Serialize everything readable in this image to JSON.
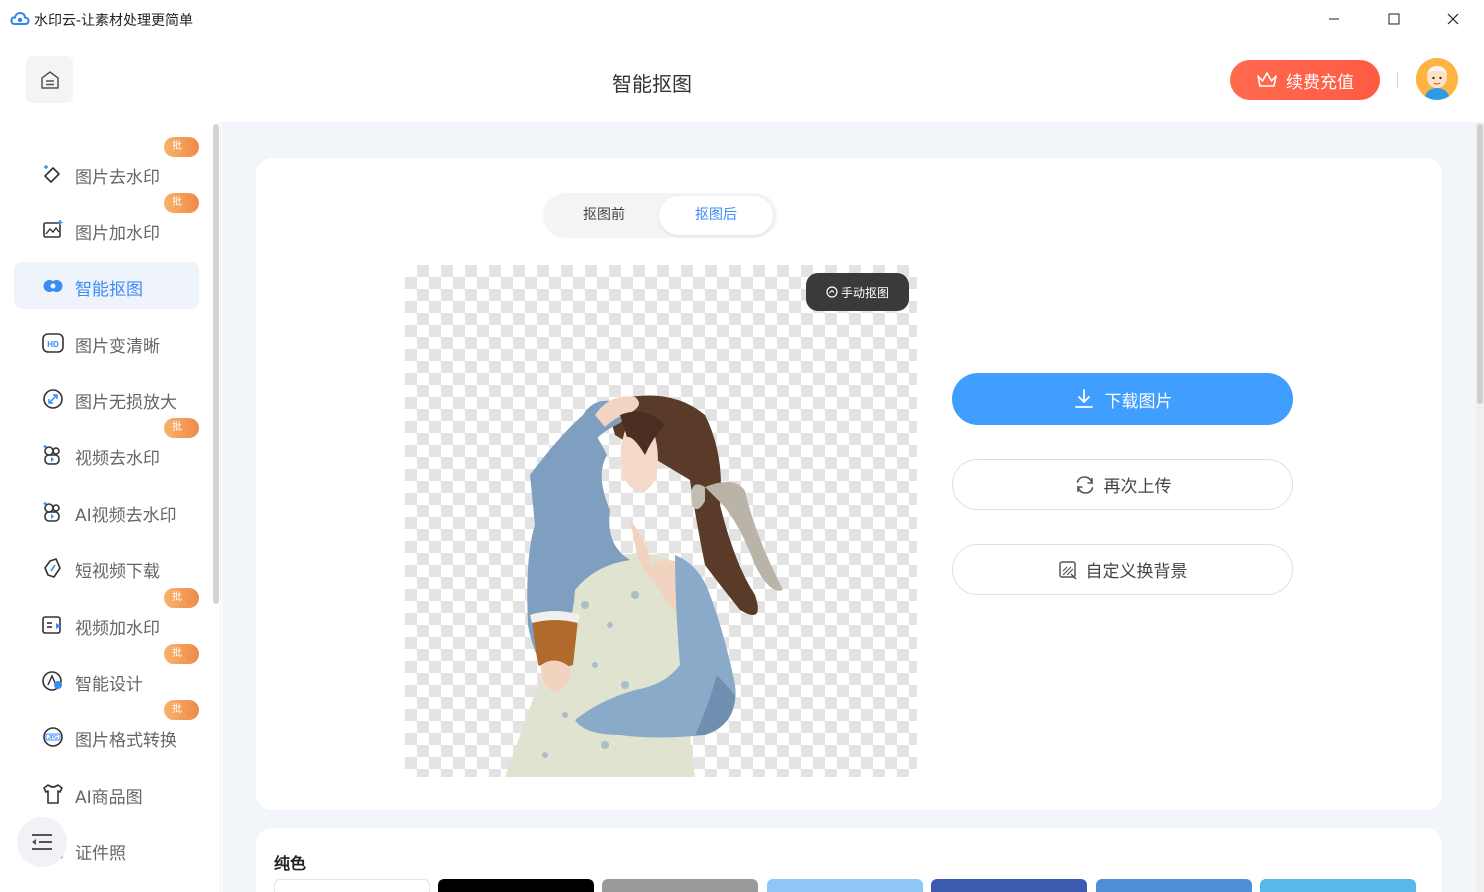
{
  "window": {
    "title": "水印云-让素材处理更简单"
  },
  "header": {
    "title": "智能抠图",
    "renew_label": "续费充值"
  },
  "sidebar": {
    "items": [
      {
        "label": "图片去水印",
        "badge": "批量",
        "icon": "eraser-icon"
      },
      {
        "label": "图片加水印",
        "badge": "批量",
        "icon": "image-add-icon"
      },
      {
        "label": "智能抠图",
        "badge": "",
        "icon": "cutout-icon",
        "active": true
      },
      {
        "label": "图片变清晰",
        "badge": "",
        "icon": "hd-icon"
      },
      {
        "label": "图片无损放大",
        "badge": "",
        "icon": "enlarge-icon"
      },
      {
        "label": "视频去水印",
        "badge": "批量",
        "icon": "video-eraser-icon"
      },
      {
        "label": "AI视频去水印",
        "badge": "",
        "icon": "ai-video-eraser-icon"
      },
      {
        "label": "短视频下载",
        "badge": "",
        "icon": "link-icon"
      },
      {
        "label": "视频加水印",
        "badge": "批量",
        "icon": "video-add-icon"
      },
      {
        "label": "智能设计",
        "badge": "批量",
        "icon": "design-icon"
      },
      {
        "label": "图片格式转换",
        "badge": "批量",
        "icon": "jpg-icon"
      },
      {
        "label": "AI商品图",
        "badge": "",
        "icon": "shirt-icon"
      },
      {
        "label": "证件照",
        "badge": "",
        "icon": "id-photo-icon"
      }
    ]
  },
  "main": {
    "tabs": {
      "before": "抠图前",
      "after": "抠图后",
      "selected": "抠图后"
    },
    "manual_label": "手动抠图",
    "download_label": "下载图片",
    "reupload_label": "再次上传",
    "custom_bg_label": "自定义换背景",
    "color_section_title": "纯色",
    "swatches": [
      "#ffffff",
      "#000000",
      "#9a9a9a",
      "#8ec6f5",
      "#3b5bb0",
      "#4d8fd9",
      "#58b8ea"
    ]
  },
  "colors": {
    "accent": "#409eff",
    "renew": "#ff5f46",
    "badge": "#f39a55"
  }
}
